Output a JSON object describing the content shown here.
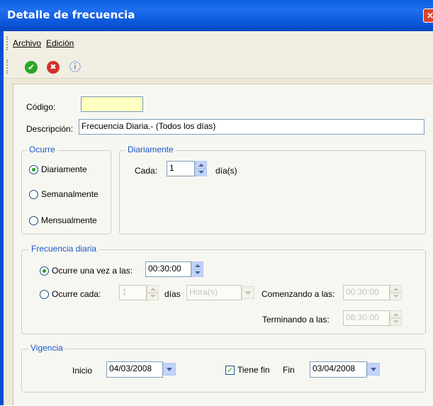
{
  "window": {
    "title": "Detalle de frecuencia",
    "close_icon": "×"
  },
  "menu": {
    "file": "Archivo",
    "edit": "Edición"
  },
  "toolbar": {
    "accept_icon": "✔",
    "cancel_icon": "✖",
    "info_icon": "ⓘ"
  },
  "form": {
    "code_label": "Código:",
    "code_value": "",
    "description_label": "Descripción:",
    "description_value": "Frecuencia  Diaria.- (Todos los días)"
  },
  "occurs": {
    "legend": "Ocurre",
    "options": [
      {
        "label": "Diariamente",
        "selected": true
      },
      {
        "label": "Semanalmente",
        "selected": false
      },
      {
        "label": "Mensualmente",
        "selected": false
      }
    ]
  },
  "daily": {
    "legend": "Diariamente",
    "every_label": "Cada:",
    "every_value": "1",
    "unit_label": "día(s)"
  },
  "daily_frequency": {
    "legend": "Frecuencia diaria",
    "once_label": "Ocurre una vez a las:",
    "once_value": "00:30:00",
    "once_selected": true,
    "every_label": "Ocurre cada:",
    "every_value": "1",
    "days_label": "días",
    "unit_value": "Hora(s)",
    "start_label": "Comenzando a las:",
    "start_value": "00:30:00",
    "end_label": "Terminando a las:",
    "end_value": "06:30:00"
  },
  "validity": {
    "legend": "Vigencia",
    "start_label": "Inicio",
    "start_value": "04/03/2008",
    "has_end_label": "Tiene fin",
    "has_end_checked": true,
    "end_label": "Fin",
    "end_value": "03/04/2008"
  },
  "colors": {
    "title_bar": "#0a5fe0",
    "accent_text": "#1c56c8",
    "code_field": "#ffffc0"
  }
}
